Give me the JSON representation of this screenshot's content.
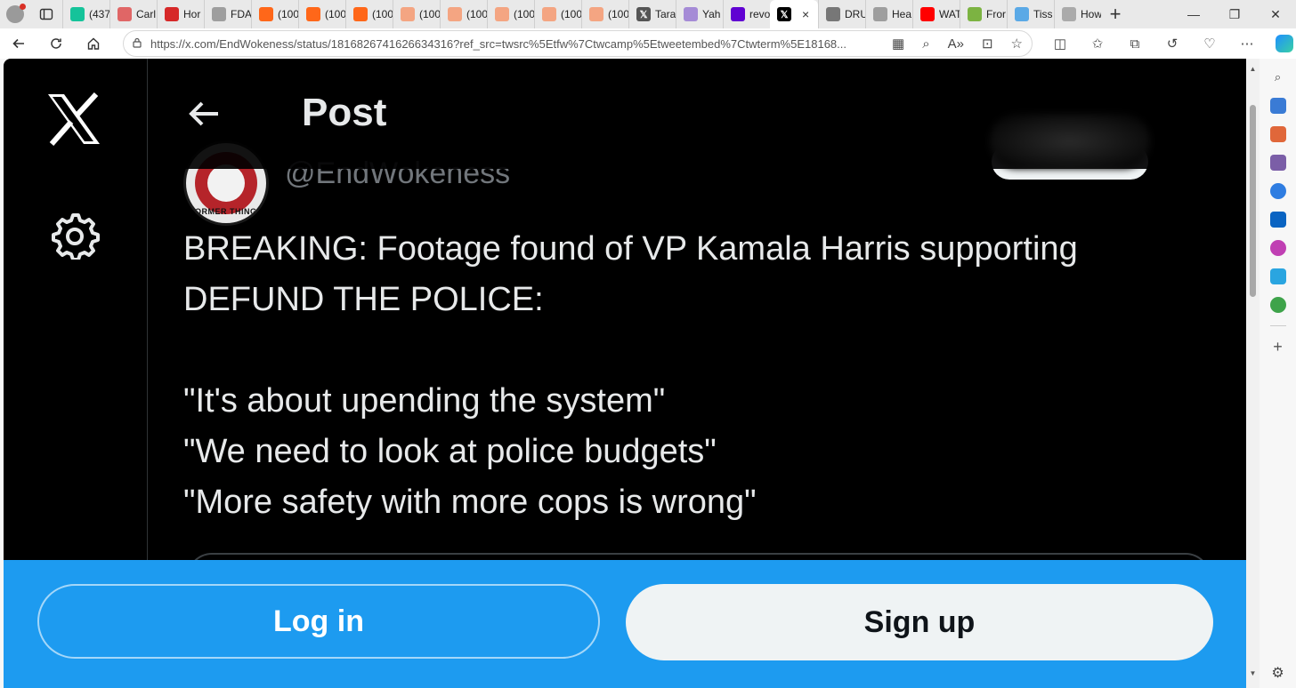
{
  "browser": {
    "tabs": [
      {
        "label": "(437",
        "icon": "grammarly-icon",
        "color": "#15c39a"
      },
      {
        "label": "Carl",
        "icon": "video-icon",
        "color": "#e06666"
      },
      {
        "label": "Hor",
        "icon": "news-icon",
        "color": "#d62828"
      },
      {
        "label": "FDA",
        "icon": "document-icon",
        "color": "#9e9e9e"
      },
      {
        "label": "(100",
        "icon": "substack-icon",
        "color": "#ff6719"
      },
      {
        "label": "(100",
        "icon": "substack-icon",
        "color": "#ff6719"
      },
      {
        "label": "(100",
        "icon": "substack-icon",
        "color": "#ff6719"
      },
      {
        "label": "(100",
        "icon": "substack-icon",
        "color": "#f4a582"
      },
      {
        "label": "(100",
        "icon": "substack-icon",
        "color": "#f4a582"
      },
      {
        "label": "(100",
        "icon": "substack-icon",
        "color": "#f4a582"
      },
      {
        "label": "(100",
        "icon": "substack-icon",
        "color": "#f4a582"
      },
      {
        "label": "(100",
        "icon": "substack-icon",
        "color": "#f4a582"
      },
      {
        "label": "Tara",
        "icon": "x-icon",
        "color": "#555555"
      },
      {
        "label": "Yah",
        "icon": "yahoo-icon",
        "color": "#a58bd6"
      },
      {
        "label": "revo",
        "icon": "yahoo-icon",
        "color": "#6001d2"
      },
      {
        "label": "",
        "icon": "x-icon",
        "color": "#000000",
        "active": true
      },
      {
        "label": "DRU",
        "icon": "drudge-icon",
        "color": "#777777"
      },
      {
        "label": "Hea",
        "icon": "document-icon",
        "color": "#9e9e9e"
      },
      {
        "label": "WAT",
        "icon": "youtube-icon",
        "color": "#ff0000"
      },
      {
        "label": "Fror",
        "icon": "globe-icon",
        "color": "#7cb342"
      },
      {
        "label": "Tiss",
        "icon": "globe-icon",
        "color": "#5aa9e6"
      },
      {
        "label": "How",
        "icon": "globe-icon",
        "color": "#aaaaaa"
      }
    ],
    "active_close": "×",
    "new_tab": "+",
    "url": "https://x.com/EndWokeness/status/1816826741626634316?ref_src=twsrc%5Etfw%7Ctwcamp%5Etweetembed%7Ctwterm%5E18168...",
    "window_controls": {
      "minimize": "—",
      "restore": "❐",
      "close": "✕"
    }
  },
  "page": {
    "header_title": "Post",
    "handle": "@EndWokeness",
    "avatar_text": "FORMER THINGS",
    "post_lines": [
      "BREAKING: Footage found of VP Kamala Harris supporting",
      "DEFUND THE POLICE:",
      "",
      "\"It's about upending the system\"",
      "\"We need to look at police budgets\"",
      "\"More safety with more cops is wrong\""
    ]
  },
  "login_bar": {
    "login_label": "Log in",
    "signup_label": "Sign up"
  },
  "colors": {
    "x_blue": "#1d9bf0",
    "background": "#000000",
    "text_primary": "#e7e9ea",
    "text_secondary": "#71767b"
  }
}
